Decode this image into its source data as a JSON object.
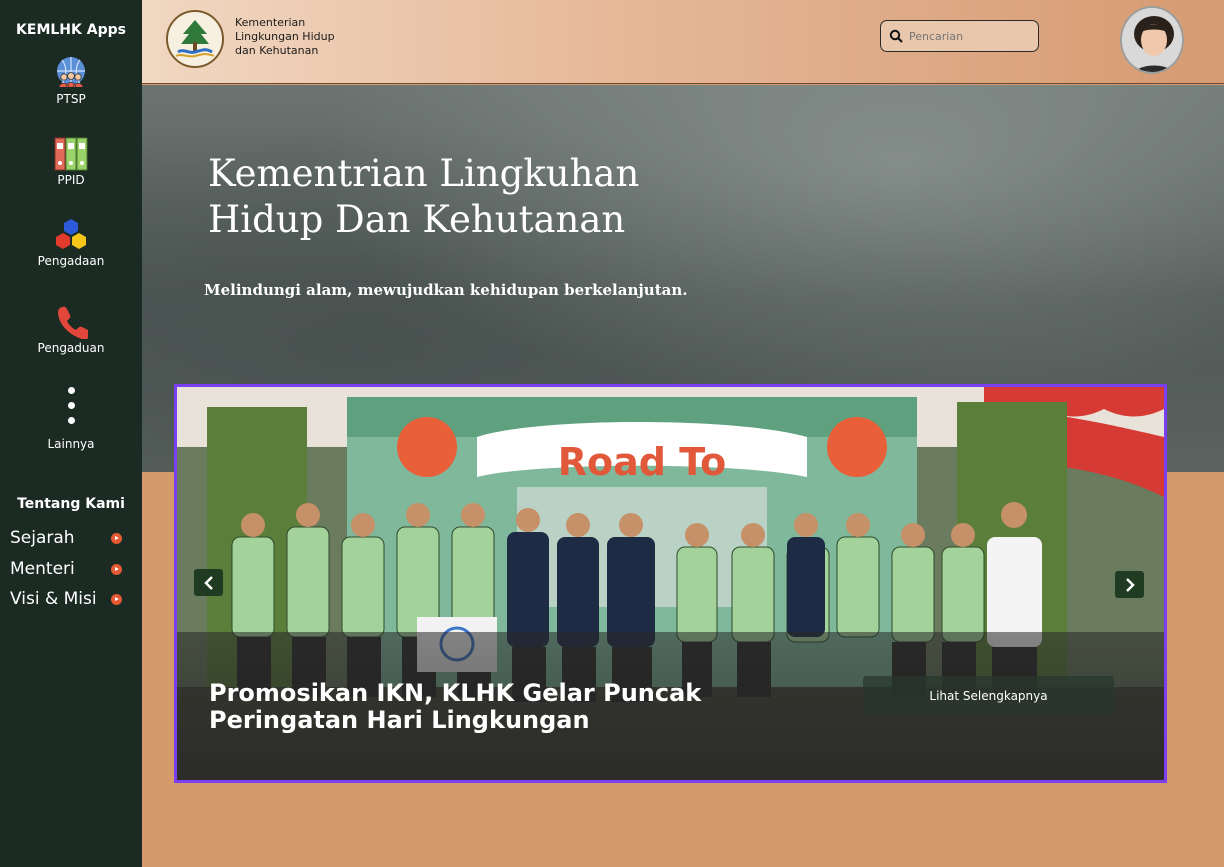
{
  "sidebar": {
    "title": "KEMLHK Apps",
    "apps": [
      {
        "label": "PTSP",
        "icon": "globe-people-icon"
      },
      {
        "label": "PPID",
        "icon": "binders-icon"
      },
      {
        "label": "Pengadaan",
        "icon": "hexagons-icon"
      },
      {
        "label": "Pengaduan",
        "icon": "phone-icon"
      },
      {
        "label": "Lainnya",
        "icon": "more-vertical-icon"
      }
    ],
    "about_title": "Tentang Kami",
    "about_links": [
      {
        "label": "Sejarah"
      },
      {
        "label": "Menteri"
      },
      {
        "label": "Visi & Misi"
      }
    ]
  },
  "header": {
    "brand_line1": "Kementerian",
    "brand_line2": "Lingkungan Hidup",
    "brand_line3": "dan Kehutanan",
    "search_placeholder": "Pencarian"
  },
  "hero": {
    "title_line1": "Kementrian Lingkuhan",
    "title_line2": "Hidup Dan Kehutanan",
    "subtitle": "Melindungi alam, mewujudkan kehidupan berkelanjutan."
  },
  "carousel": {
    "headline_line1": "Promosikan IKN, KLHK Gelar Puncak",
    "headline_line2": "Peringatan Hari Lingkungan",
    "more_label": "Lihat Selengkapnya",
    "banner_text": "Road To"
  },
  "colors": {
    "sidebar_bg": "#1b2a22",
    "accent": "#e65a33",
    "carousel_border": "#7a3ff0"
  }
}
